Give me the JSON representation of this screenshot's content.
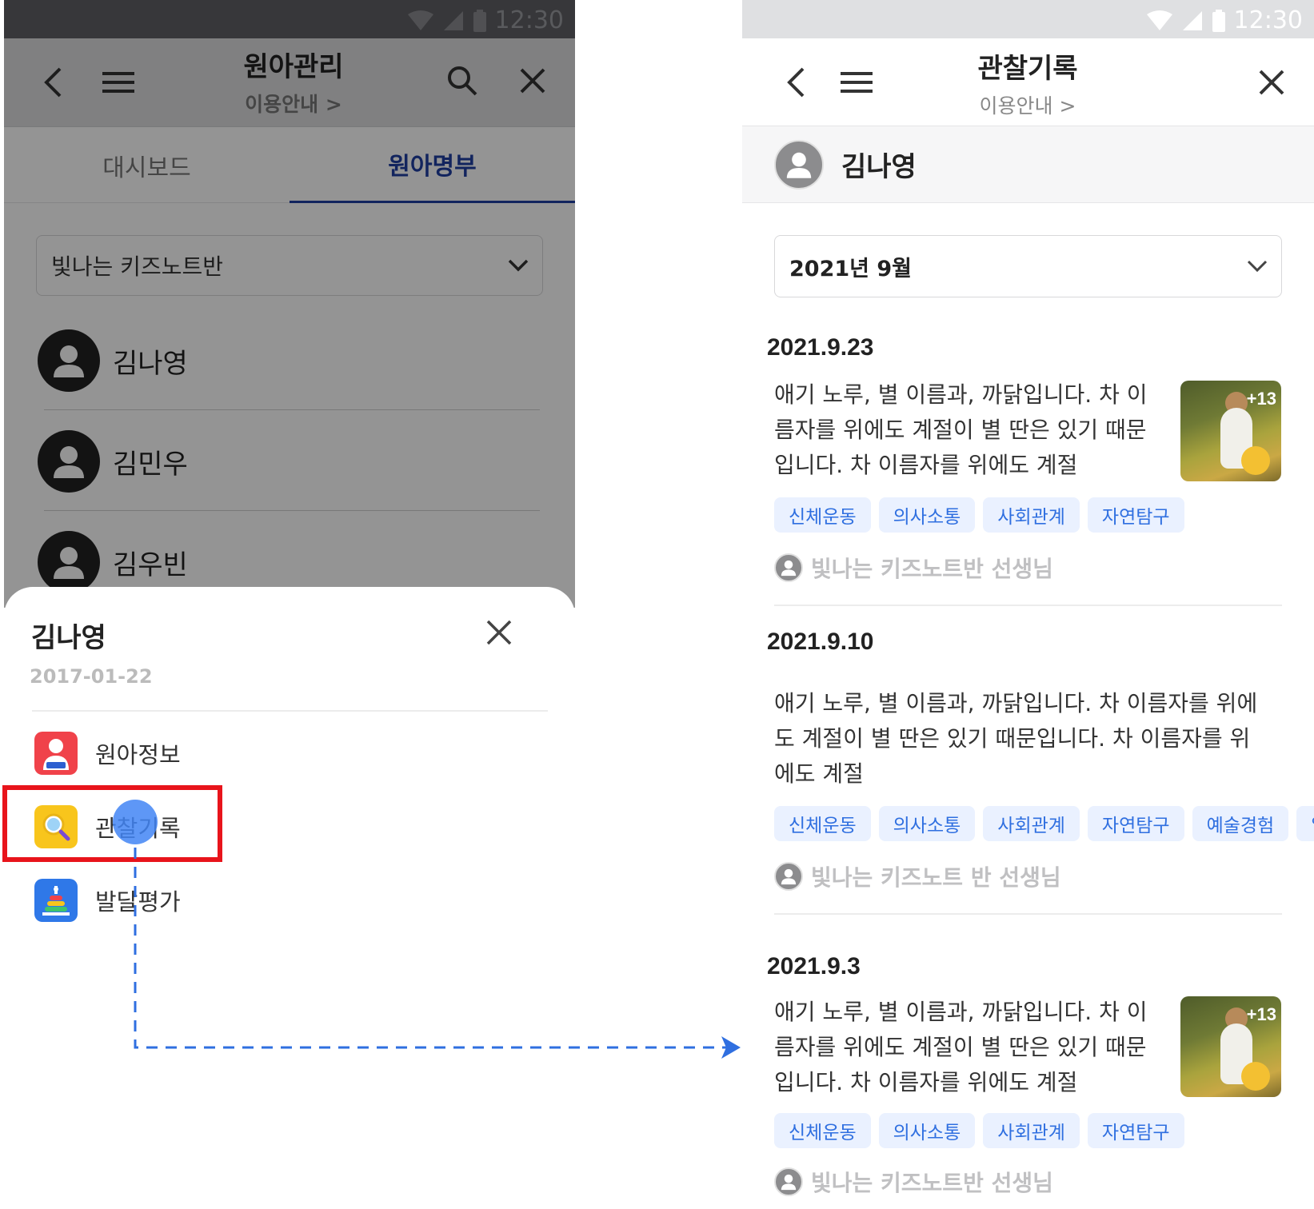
{
  "left": {
    "status_time": "12:30",
    "appbar": {
      "title": "원아관리",
      "subtitle": "이용안내 >"
    },
    "tabs": [
      {
        "label": "대시보드"
      },
      {
        "label": "원아명부"
      }
    ],
    "class_select": {
      "value": "빛나는 키즈노트반"
    },
    "students": [
      {
        "name": "김나영"
      },
      {
        "name": "김민우"
      },
      {
        "name": "김우빈"
      }
    ],
    "sheet": {
      "name": "김나영",
      "birth_date": "2017-01-22",
      "menu": [
        {
          "label": "원아정보",
          "icon": "child-info-icon"
        },
        {
          "label": "관찰기록",
          "icon": "magnifier-icon"
        },
        {
          "label": "발달평가",
          "icon": "ring-stack-icon"
        }
      ]
    }
  },
  "right": {
    "status_time": "12:30",
    "appbar": {
      "title": "관찰기록",
      "subtitle": "이용안내 >"
    },
    "child_name": "김나영",
    "month_select": {
      "value": "2021년 9월"
    },
    "records": [
      {
        "date": "2021.9.23",
        "lines": [
          "애기 노루, 별 이름과, 까닭입니다. 차 이",
          "름자를 위에도 계절이 별 딴은 있기 때문",
          "입니다. 차 이름자를 위에도 계절"
        ],
        "photo_count": "+13",
        "tags": [
          "신체운동",
          "의사소통",
          "사회관계",
          "자연탐구"
        ],
        "teacher": "빛나는 키즈노트반 선생님"
      },
      {
        "date": "2021.9.10",
        "lines": [
          "애기 노루, 별 이름과, 까닭입니다. 차 이름자를 위에",
          "도 계절이 별 딴은 있기 때문입니다. 차 이름자를 위",
          "에도 계절"
        ],
        "tags": [
          "신체운동",
          "의사소통",
          "사회관계",
          "자연탐구",
          "예술경험",
          "일"
        ],
        "teacher": "빛나는 키즈노트 반 선생님"
      },
      {
        "date": "2021.9.3",
        "lines": [
          "애기 노루, 별 이름과, 까닭입니다. 차 이",
          "름자를 위에도 계절이 별 딴은 있기 때문",
          "입니다. 차 이름자를 위에도 계절"
        ],
        "photo_count": "+13",
        "tags": [
          "신체운동",
          "의사소통",
          "사회관계",
          "자연탐구"
        ],
        "teacher": "빛나는 키즈노트반 선생님"
      }
    ]
  },
  "colors": {
    "accent_blue": "#1f3fa3",
    "highlight_red": "#e8141b",
    "tag_text": "#2f6fe0",
    "tag_bg": "#eaf1ff",
    "connector": "#2f6fe0"
  }
}
